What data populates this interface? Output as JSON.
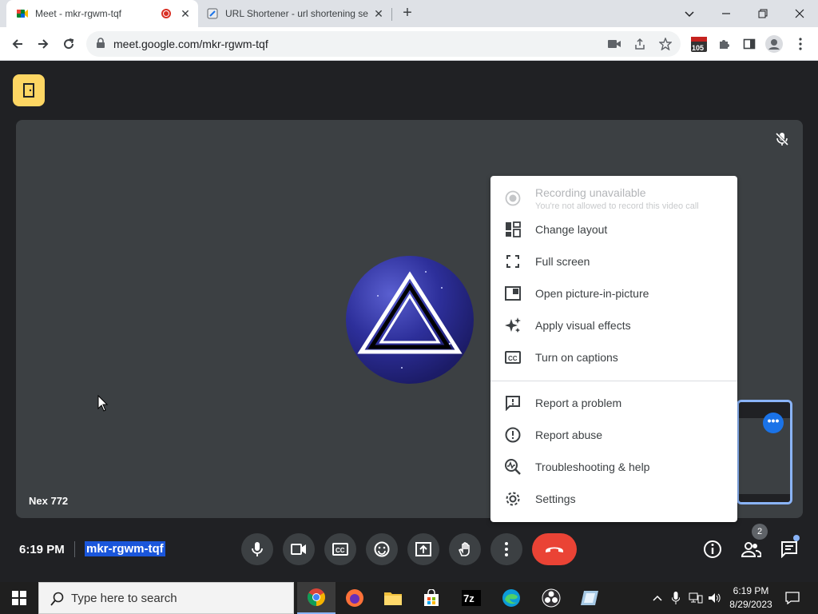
{
  "browser": {
    "tabs": [
      {
        "title": "Meet - mkr-rgwm-tqf",
        "active": true,
        "recording": true
      },
      {
        "title": "URL Shortener - url shortening se",
        "active": false
      }
    ],
    "address": {
      "url": "meet.google.com/mkr-rgwm-tqf"
    },
    "extension_badge": "105"
  },
  "meet": {
    "participant_name": "Nex 772",
    "clock": "6:19 PM",
    "meeting_code": "mkr-rgwm-tqf",
    "participants_count": "2",
    "menu": {
      "recording": {
        "label": "Recording unavailable",
        "sub": "You're not allowed to record this video call"
      },
      "items": [
        {
          "label": "Change layout",
          "icon": "layout-icon"
        },
        {
          "label": "Full screen",
          "icon": "fullscreen-icon"
        },
        {
          "label": "Open picture-in-picture",
          "icon": "picture-in-picture-icon"
        },
        {
          "label": "Apply visual effects",
          "icon": "sparkle-icon"
        },
        {
          "label": "Turn on captions",
          "icon": "captions-icon"
        }
      ],
      "items2": [
        {
          "label": "Report a problem",
          "icon": "feedback-icon"
        },
        {
          "label": "Report abuse",
          "icon": "alert-icon"
        },
        {
          "label": "Troubleshooting & help",
          "icon": "troubleshoot-icon"
        },
        {
          "label": "Settings",
          "icon": "gear-icon"
        }
      ]
    }
  },
  "taskbar": {
    "search_placeholder": "Type here to search",
    "time": "6:19 PM",
    "date": "8/29/2023"
  },
  "colors": {
    "meet_bg": "#202124",
    "stage_bg": "#3c4043",
    "hangup": "#ea4335",
    "exit_button": "#fdd663",
    "code_highlight": "#1a56db"
  }
}
